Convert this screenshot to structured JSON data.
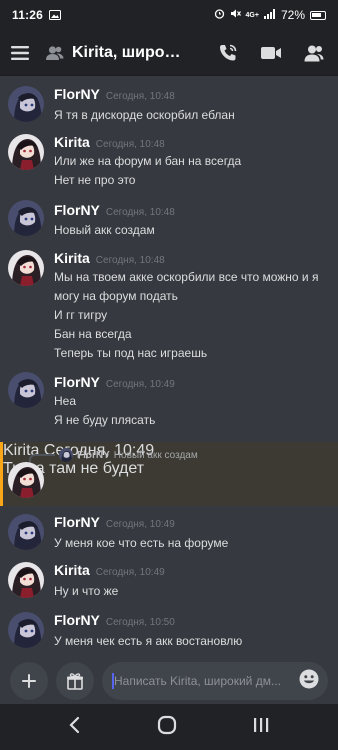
{
  "status_bar": {
    "time": "11:26",
    "battery": "72%",
    "network": "4G+"
  },
  "header": {
    "title": "Kirita, широ…",
    "icons": [
      "hamburger-menu-icon",
      "dm-user-icon",
      "voice-call-icon",
      "video-call-icon",
      "member-list-icon"
    ]
  },
  "users": {
    "flor": "FlorNY",
    "kirita": "Kirita"
  },
  "messages": [
    {
      "author": "FlorNY",
      "timestamp": "Сегодня, 10:48",
      "lines": [
        "Я тя в дискорде оскорбил еблан"
      ]
    },
    {
      "author": "Kirita",
      "timestamp": "Сегодня, 10:48",
      "lines": [
        "Или же на форум и бан на всегда",
        "Нет не про это"
      ]
    },
    {
      "author": "FlorNY",
      "timestamp": "Сегодня, 10:48",
      "lines": [
        "Новый акк создам"
      ]
    },
    {
      "author": "Kirita",
      "timestamp": "Сегодня, 10:48",
      "lines": [
        "Мы на твоем акке оскорбили все что можно и я",
        "могу на форум подать",
        "И гг тигру",
        "Бан на всегда",
        "Теперь ты под нас играешь"
      ]
    },
    {
      "author": "FlorNY",
      "timestamp": "Сегодня, 10:49",
      "lines": [
        "Неа",
        "Я не буду плясать"
      ]
    },
    {
      "author": "Kirita",
      "timestamp": "Сегодня, 10:49",
      "lines": [
        "Тигра там не будет"
      ],
      "reply_to": {
        "author": "FlorNY",
        "text": "Новый акк создам"
      }
    },
    {
      "author": "FlorNY",
      "timestamp": "Сегодня, 10:49",
      "lines": [
        "У меня кое что есть на форуме"
      ]
    },
    {
      "author": "Kirita",
      "timestamp": "Сегодня, 10:49",
      "lines": [
        "Ну и что же"
      ]
    },
    {
      "author": "FlorNY",
      "timestamp": "Сегодня, 10:50",
      "lines": [
        "У меня чек есть я акк востановлю"
      ]
    }
  ],
  "composer": {
    "placeholder": "Написать Kirita, широкий дм...",
    "value": ""
  },
  "colors": {
    "background": "#36393f",
    "bars": "#202225",
    "reply_highlight": "#faa61a",
    "input": "#40444b"
  }
}
